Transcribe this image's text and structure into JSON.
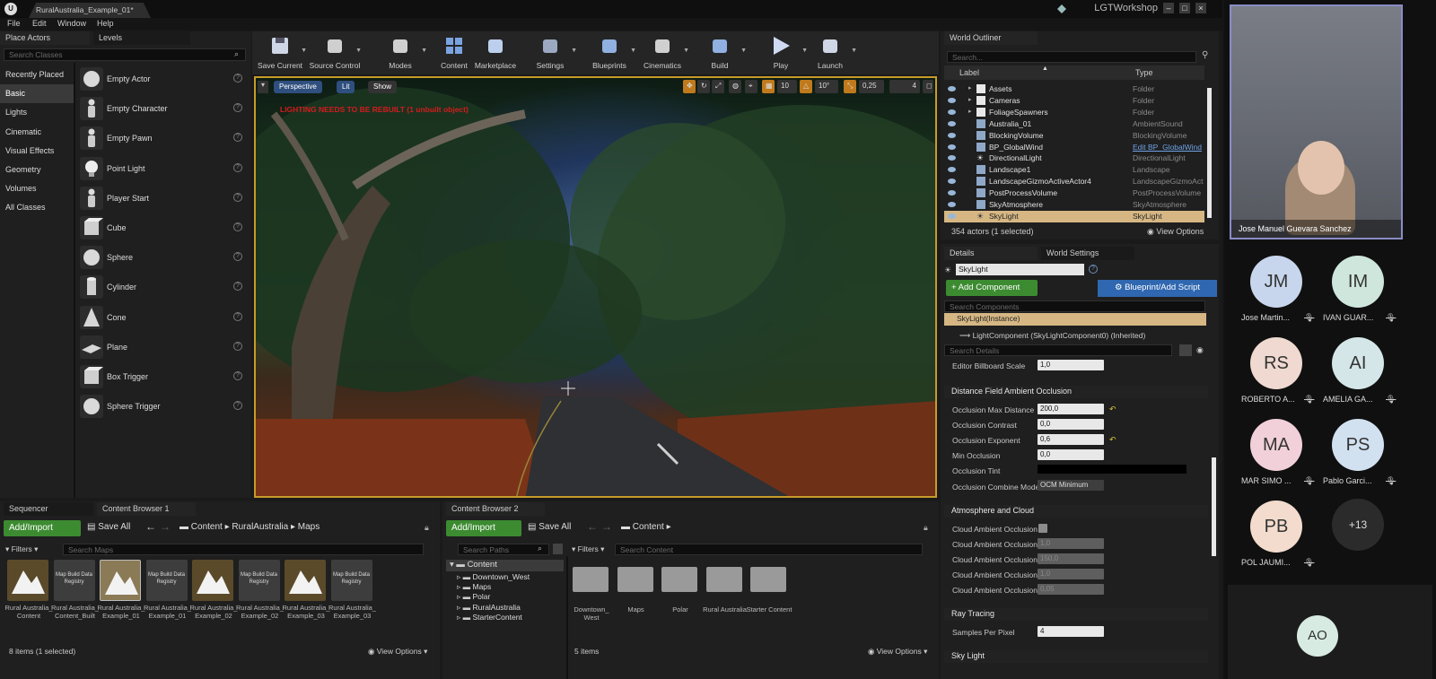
{
  "window": {
    "doc_tab": "RuralAustralia_Example_01*",
    "project_name": "LGTWorkshop",
    "menu": [
      "File",
      "Edit",
      "Window",
      "Help"
    ]
  },
  "place_actors": {
    "tab": "Place Actors",
    "tab2": "Levels",
    "search_placeholder": "Search Classes",
    "categories": [
      "Recently Placed",
      "Basic",
      "Lights",
      "Cinematic",
      "Visual Effects",
      "Geometry",
      "Volumes",
      "All Classes"
    ],
    "active_category": "Basic",
    "actors": [
      "Empty Actor",
      "Empty Character",
      "Empty Pawn",
      "Point Light",
      "Player Start",
      "Cube",
      "Sphere",
      "Cylinder",
      "Cone",
      "Plane",
      "Box Trigger",
      "Sphere Trigger"
    ]
  },
  "toolbar": [
    {
      "label": "Save Current",
      "icon": "save-icon"
    },
    {
      "label": "Source Control",
      "icon": "source-control-icon"
    },
    {
      "label": "Modes",
      "icon": "modes-icon"
    },
    {
      "label": "Content",
      "icon": "content-icon"
    },
    {
      "label": "Marketplace",
      "icon": "marketplace-icon"
    },
    {
      "label": "Settings",
      "icon": "settings-icon"
    },
    {
      "label": "Blueprints",
      "icon": "blueprints-icon"
    },
    {
      "label": "Cinematics",
      "icon": "cinematics-icon"
    },
    {
      "label": "Build",
      "icon": "build-icon"
    },
    {
      "label": "Play",
      "icon": "play-icon"
    },
    {
      "label": "Launch",
      "icon": "launch-icon"
    }
  ],
  "viewport": {
    "perspective": "Perspective",
    "lit": "Lit",
    "show": "Show",
    "warning": "LIGHTING NEEDS TO BE REBUILT (1 unbuilt object)",
    "grid_snap": "10",
    "rot_snap": "10°",
    "scale_snap": "0,25",
    "cam_speed": "4"
  },
  "outliner": {
    "tab": "World Outliner",
    "search_placeholder": "Search...",
    "col_label": "Label",
    "col_type": "Type",
    "rows": [
      {
        "name": "Assets",
        "type": "Folder",
        "kind": "folder"
      },
      {
        "name": "Cameras",
        "type": "Folder",
        "kind": "folder"
      },
      {
        "name": "FoliageSpawners",
        "type": "Folder",
        "kind": "folder"
      },
      {
        "name": "Australia_01",
        "type": "AmbientSound",
        "kind": "actor"
      },
      {
        "name": "BlockingVolume",
        "type": "BlockingVolume",
        "kind": "actor"
      },
      {
        "name": "BP_GlobalWind",
        "type": "Edit BP_GlobalWind",
        "kind": "blueprint"
      },
      {
        "name": "DirectionalLight",
        "type": "DirectionalLight",
        "kind": "light"
      },
      {
        "name": "Landscape1",
        "type": "Landscape",
        "kind": "actor"
      },
      {
        "name": "LandscapeGizmoActiveActor4",
        "type": "LandscapeGizmoAct",
        "kind": "actor"
      },
      {
        "name": "PostProcessVolume",
        "type": "PostProcessVolume",
        "kind": "actor"
      },
      {
        "name": "SkyAtmosphere",
        "type": "SkyAtmosphere",
        "kind": "actor"
      },
      {
        "name": "SkyLight",
        "type": "SkyLight",
        "kind": "light"
      }
    ],
    "status": "354 actors (1 selected)",
    "view_options": "View Options"
  },
  "details": {
    "tab": "Details",
    "tab2": "World Settings",
    "object_name": "SkyLight",
    "add_component": "+ Add Component",
    "blueprint_script": "Blueprint/Add Script",
    "search_components": "Search Components",
    "instance": "SkyLight(Instance)",
    "light_component": "LightComponent (SkyLightComponent0) (Inherited)",
    "search_details": "Search Details",
    "billboard_label": "Editor Billboard Scale",
    "billboard_value": "1,0",
    "sections": {
      "dfao": "Distance Field Ambient Occlusion",
      "atmo": "Atmosphere and Cloud",
      "ray": "Ray Tracing",
      "sky": "Sky Light"
    },
    "dfao_props": [
      {
        "label": "Occlusion Max Distance",
        "value": "200,0"
      },
      {
        "label": "Occlusion Contrast",
        "value": "0,0"
      },
      {
        "label": "Occlusion Exponent",
        "value": "0,6"
      },
      {
        "label": "Min Occlusion",
        "value": "0,0"
      }
    ],
    "occlusion_tint": "Occlusion Tint",
    "combine_mode_label": "Occlusion Combine Mode",
    "combine_mode_value": "OCM Minimum",
    "cloud_checkbox_label": "Cloud Ambient Occlusion",
    "cloud_props": [
      {
        "label": "Cloud Ambient Occlusion",
        "value": "1,0"
      },
      {
        "label": "Cloud Ambient Occlusion",
        "value": "150,0"
      },
      {
        "label": "Cloud Ambient Occlusion",
        "value": "1,0"
      },
      {
        "label": "Cloud Ambient Occlusion",
        "value": "0,05"
      }
    ],
    "spp_label": "Samples Per Pixel",
    "spp_value": "4"
  },
  "bottom_left": {
    "tab1": "Sequencer",
    "tab2": "Content Browser 1",
    "add_import": "Add/Import",
    "save_all": "Save All",
    "path": [
      "Content",
      "RuralAustralia",
      "Maps"
    ],
    "filters": "Filters",
    "search_placeholder": "Search Maps",
    "assets": [
      {
        "label": "Rural Australia_ Content",
        "kind": "map",
        "thumb": ""
      },
      {
        "label": "Rural Australia_ Content_Built",
        "kind": "registry",
        "thumb": "Map Build Data Registry"
      },
      {
        "label": "Rural Australia_ Example_01",
        "kind": "map-selected",
        "thumb": ""
      },
      {
        "label": "Rural Australia_ Example_01",
        "kind": "registry",
        "thumb": "Map Build Data Registry"
      },
      {
        "label": "Rural Australia_ Example_02",
        "kind": "map",
        "thumb": ""
      },
      {
        "label": "Rural Australia_ Example_02",
        "kind": "registry",
        "thumb": "Map Build Data Registry"
      },
      {
        "label": "Rural Australia_ Example_03",
        "kind": "map",
        "thumb": ""
      },
      {
        "label": "Rural Australia_ Example_03",
        "kind": "registry",
        "thumb": "Map Build Data Registry"
      }
    ],
    "status": "8 items (1 selected)",
    "view_options": "View Options"
  },
  "bottom_right": {
    "tab": "Content Browser 2",
    "add_import": "Add/Import",
    "save_all": "Save All",
    "path": [
      "Content"
    ],
    "search_paths": "Search Paths",
    "filters": "Filters",
    "search_content": "Search Content",
    "tree": [
      "Content",
      "Downtown_West",
      "Maps",
      "Polar",
      "RuralAustralia",
      "StarterContent"
    ],
    "folders": [
      "Downtown_ West",
      "Maps",
      "Polar",
      "Rural Australia",
      "Starter Content"
    ],
    "status": "5 items",
    "view_options": "View Options"
  },
  "teams": {
    "speaker": "Jose Manuel Guevara Sanchez",
    "participants": [
      {
        "initials": "JM",
        "name": "Jose Martin...",
        "color": "#c7d6ec"
      },
      {
        "initials": "IM",
        "name": "IVAN GUAR...",
        "color": "#cfe6dd"
      },
      {
        "initials": "RS",
        "name": "ROBERTO A...",
        "color": "#efd9d0"
      },
      {
        "initials": "AI",
        "name": "AMELIA GA...",
        "color": "#d4e6e8"
      },
      {
        "initials": "MA",
        "name": "MAR SIMO ...",
        "color": "#f1d0da"
      },
      {
        "initials": "PS",
        "name": "Pablo Garci...",
        "color": "#d2e1f0"
      },
      {
        "initials": "PB",
        "name": "POL JAUMI...",
        "color": "#f3dccd"
      }
    ],
    "more": "+13",
    "self_initials": "AO",
    "self_color": "#d7ebe3"
  }
}
